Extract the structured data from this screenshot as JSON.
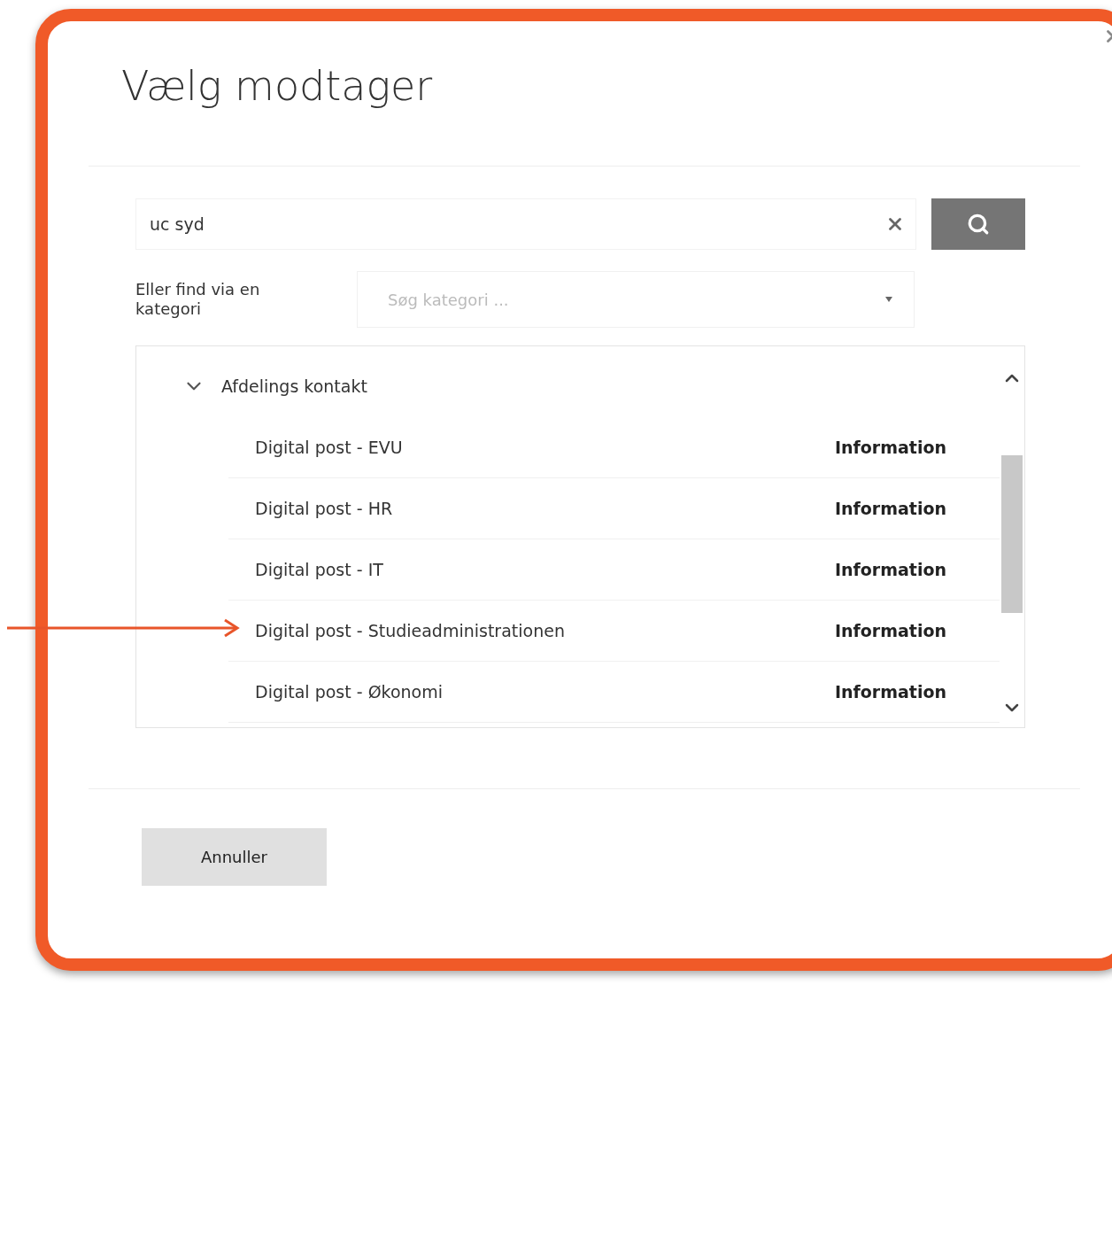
{
  "dialog": {
    "title": "Vælg modtager"
  },
  "search": {
    "value": "uc syd"
  },
  "category": {
    "label": "Eller find via en kategori",
    "placeholder": "Søg kategori ..."
  },
  "results": {
    "group": {
      "label": "Afdelings kontakt",
      "expanded": true,
      "items": [
        {
          "name": "Digital post - EVU",
          "action": "Information"
        },
        {
          "name": "Digital post - HR",
          "action": "Information"
        },
        {
          "name": "Digital post - IT",
          "action": "Information"
        },
        {
          "name": "Digital post - Studieadministrationen",
          "action": "Information"
        },
        {
          "name": "Digital post - Økonomi",
          "action": "Information"
        }
      ]
    }
  },
  "footer": {
    "cancel": "Annuller"
  }
}
